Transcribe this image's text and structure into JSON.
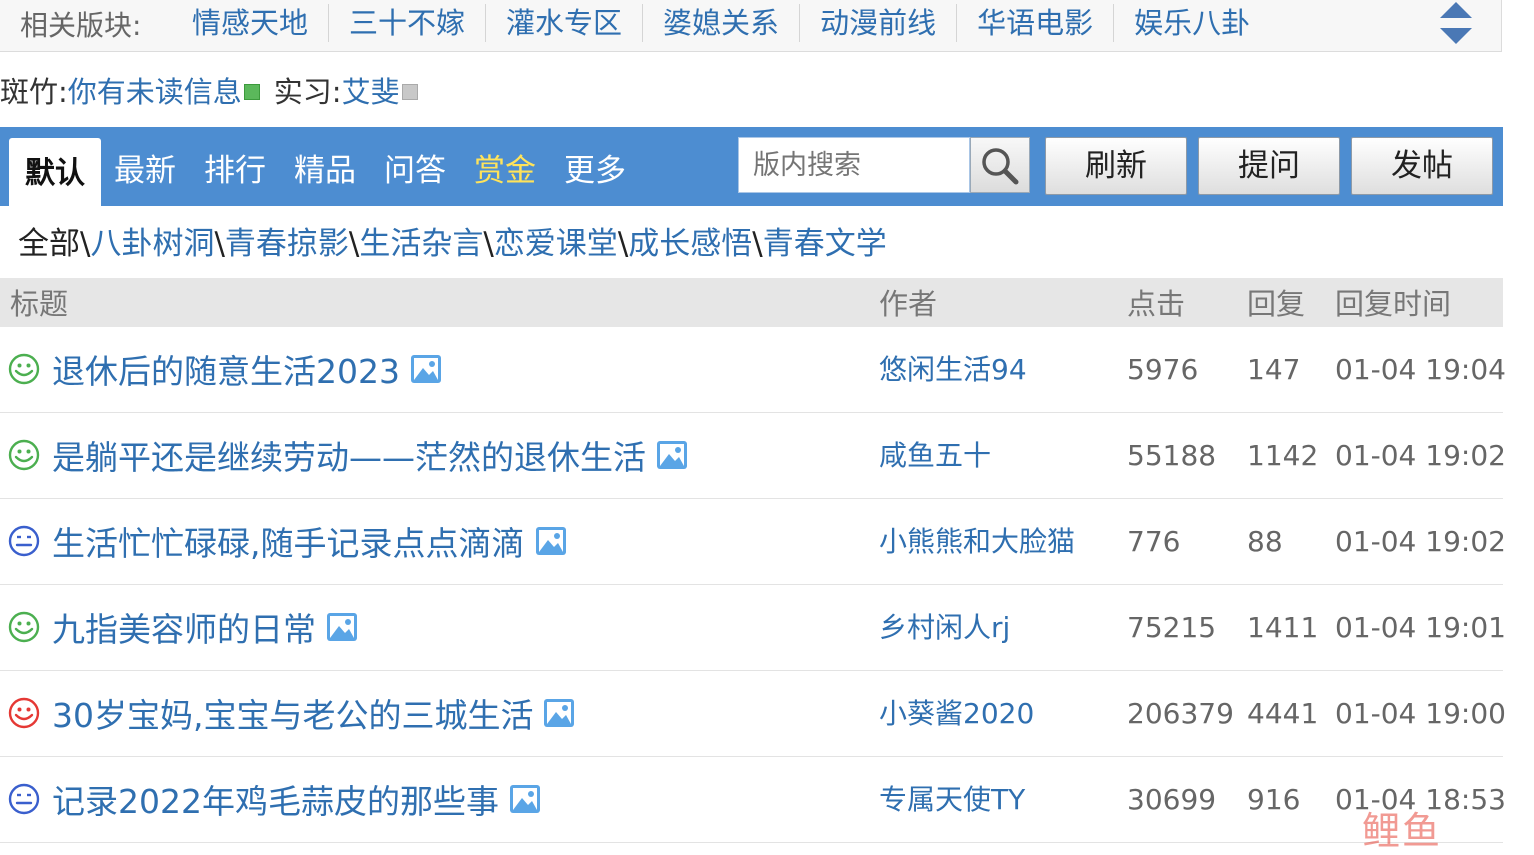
{
  "related": {
    "label": "相关版块:",
    "links": [
      "情感天地",
      "三十不嫁",
      "灌水专区",
      "婆媳关系",
      "动漫前线",
      "华语电影",
      "娱乐八卦"
    ]
  },
  "moderators": {
    "host_key": "斑竹:",
    "host_val": "你有未读信息",
    "intern_key": "实习:",
    "intern_val": "艾斐"
  },
  "tabs": [
    "默认",
    "最新",
    "排行",
    "精品",
    "问答",
    "赏金",
    "更多"
  ],
  "search": {
    "placeholder": "版内搜索"
  },
  "buttons": {
    "refresh": "刷新",
    "ask": "提问",
    "post": "发帖"
  },
  "categories": {
    "all": "全部",
    "items": [
      "八卦树洞",
      "青春掠影",
      "生活杂言",
      "恋爱课堂",
      "成长感悟",
      "青春文学"
    ],
    "sep": "\\"
  },
  "table": {
    "headers": {
      "title": "标题",
      "author": "作者",
      "clicks": "点击",
      "replies": "回复",
      "time": "回复时间"
    },
    "rows": [
      {
        "mood": "green",
        "title": "退休后的随意生活2023",
        "author": "悠闲生活94",
        "clicks": "5976",
        "replies": "147",
        "time": "01-04 19:04"
      },
      {
        "mood": "green",
        "title": "是躺平还是继续劳动——茫然的退休生活",
        "author": "咸鱼五十",
        "clicks": "55188",
        "replies": "1142",
        "time": "01-04 19:02"
      },
      {
        "mood": "blue",
        "title": "生活忙忙碌碌,随手记录点点滴滴",
        "author": "小熊熊和大脸猫",
        "clicks": "776",
        "replies": "88",
        "time": "01-04 19:02"
      },
      {
        "mood": "green",
        "title": "九指美容师的日常",
        "author": "乡村闲人rj",
        "clicks": "75215",
        "replies": "1411",
        "time": "01-04 19:01"
      },
      {
        "mood": "red",
        "title": "30岁宝妈,宝宝与老公的三城生活",
        "author": "小葵酱2020",
        "clicks": "206379",
        "replies": "4441",
        "time": "01-04 19:00"
      },
      {
        "mood": "blue",
        "title": "记录2022年鸡毛蒜皮的那些事",
        "author": "专属天使TY",
        "clicks": "30699",
        "replies": "916",
        "time": "01-04 18:53"
      }
    ]
  },
  "watermark": "鲤鱼",
  "colors": {
    "accent": "#4d8dd1",
    "link": "#2f6fb0",
    "gold": "#ffe35a",
    "mood_green": "#4caf50",
    "mood_blue": "#3a5fcd",
    "mood_red": "#e53935"
  }
}
